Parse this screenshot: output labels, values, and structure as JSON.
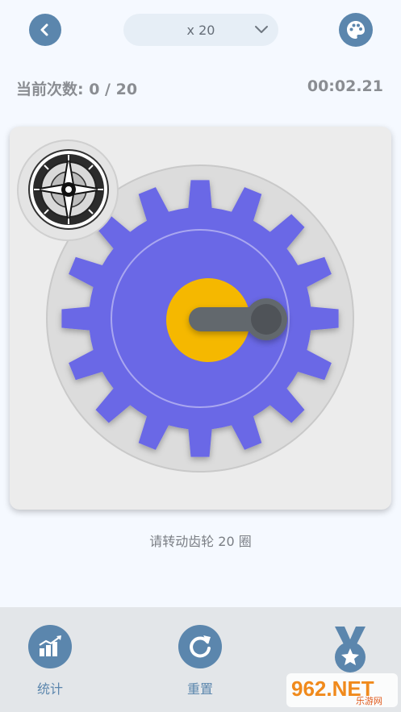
{
  "header": {
    "back_icon": "chevron-left-icon",
    "multiplier_value": "x 20",
    "dropdown_icon": "chevron-down-icon",
    "palette_icon": "palette-icon"
  },
  "status": {
    "count_label": "当前次数: 0 / 20",
    "timer": "00:02.21"
  },
  "gear": {
    "gear_color": "#6b67e6",
    "hub_color": "#f5b800",
    "handle_color": "#62676d",
    "badge_icon": "clock-medallion-icon"
  },
  "hint": "请转动齿轮 20 圈",
  "bottom_nav": {
    "stats_label": "统计",
    "stats_icon": "bar-chart-icon",
    "reset_label": "重置",
    "reset_icon": "refresh-icon",
    "medal_icon": "medal-icon"
  },
  "watermark": {
    "brand": "962.NET",
    "sub": "乐游网"
  }
}
